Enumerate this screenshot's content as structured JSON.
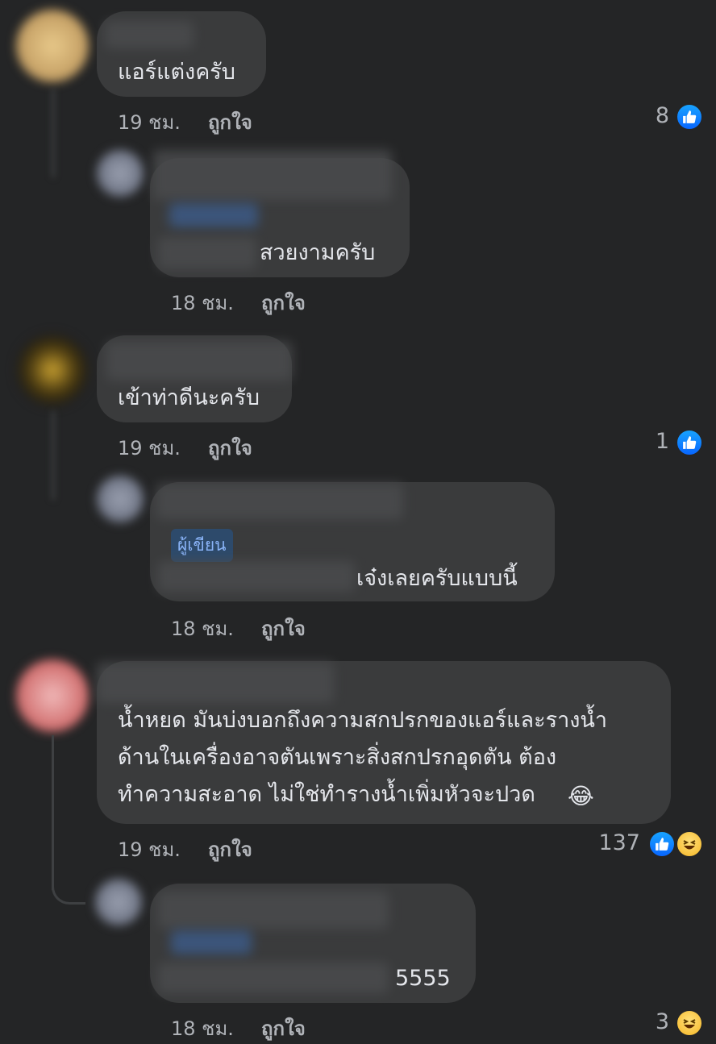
{
  "comments": [
    {
      "text": "แอร์แต่งครับ",
      "time": "19 ชม.",
      "like_label": "ถูกใจ",
      "reaction_count": "8",
      "reactions": [
        "like-icon"
      ],
      "reply": {
        "text": "สวยงามครับ",
        "time": "18 ชม.",
        "like_label": "ถูกใจ"
      }
    },
    {
      "text": "เข้าท่าดีนะครับ",
      "time": "19 ชม.",
      "like_label": "ถูกใจ",
      "reaction_count": "1",
      "reactions": [
        "like-icon"
      ],
      "reply": {
        "badge": "ผู้เขียน",
        "text": "เจ๋งเลยครับแบบนี้",
        "time": "18 ชม.",
        "like_label": "ถูกใจ"
      }
    },
    {
      "lines": [
        "น้ำหยด มันบ่งบอกถึงความสกปรกของแอร์และรางน้ำ",
        "ด้านในเครื่องอาจตันเพราะสิ่งสกปรกอุดตัน ต้อง",
        "ทำความสะอาด ไม่ใช่ทำรางน้ำเพิ่มหัวจะปวด"
      ],
      "emoji": "😂",
      "time": "19 ชม.",
      "like_label": "ถูกใจ",
      "reaction_count": "137",
      "reactions": [
        "like-icon",
        "haha-icon"
      ],
      "reply": {
        "text": "5555",
        "time": "18 ชม.",
        "like_label": "ถูกใจ",
        "reaction_count": "3",
        "reactions": [
          "haha-icon"
        ]
      }
    }
  ],
  "colors": {
    "background": "#242526",
    "bubble": "#3a3b3c",
    "text": "#e4e6eb",
    "meta": "#b0b3b8",
    "like_blue": "#0866ff",
    "haha_yellow": "#f5b625"
  }
}
